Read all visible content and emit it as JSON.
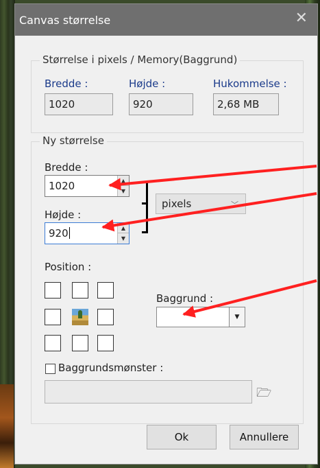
{
  "dialog": {
    "title": "Canvas størrelse",
    "close_icon": "close-icon"
  },
  "current": {
    "group_title": "Størrelse i pixels / Memory(Baggrund)",
    "width_label": "Bredde :",
    "width_value": "1020",
    "height_label": "Højde :",
    "height_value": "920",
    "memory_label": "Hukommelse :",
    "memory_value": "2,68 MB"
  },
  "new_size": {
    "group_title": "Ny størrelse",
    "width_label": "Bredde :",
    "width_value": "1020",
    "height_label": "Højde :",
    "height_value": "920",
    "unit_value": "pixels"
  },
  "position": {
    "label": "Position :",
    "selected": "center"
  },
  "background": {
    "label": "Baggrund :",
    "value": ""
  },
  "pattern": {
    "label": "Baggrundsmønster :",
    "checked": false,
    "path": ""
  },
  "buttons": {
    "ok": "Ok",
    "cancel": "Annullere"
  },
  "annotation_color": "#ff2020"
}
